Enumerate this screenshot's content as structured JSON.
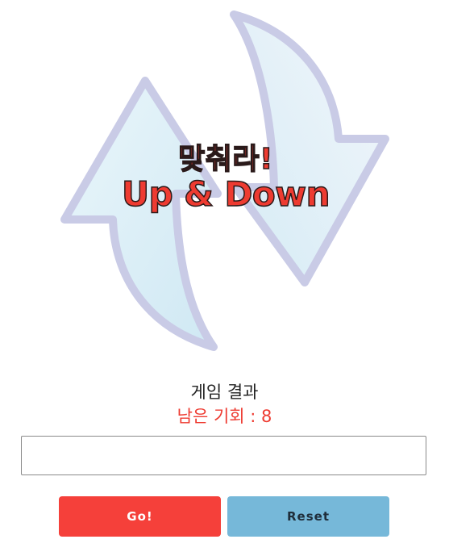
{
  "hero": {
    "title_line1": "맞춰라!",
    "title_line2": "Up & Down"
  },
  "status": {
    "result_label": "게임 결과",
    "remaining_text": "남은 기회 : 8"
  },
  "input": {
    "value": "",
    "placeholder": ""
  },
  "buttons": {
    "go_label": "Go!",
    "reset_label": "Reset"
  },
  "colors": {
    "accent_red": "#f5403a",
    "reset_blue": "#76b8d9",
    "arrow_outline": "#c9cbe6"
  }
}
